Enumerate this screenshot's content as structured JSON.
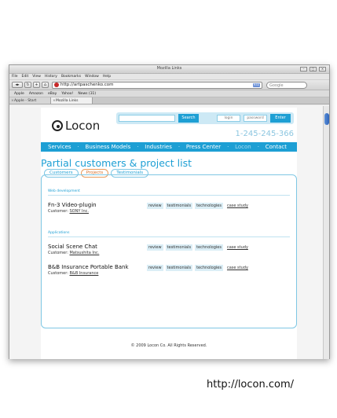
{
  "window": {
    "title": "Mozilla Links",
    "controls": [
      "–",
      "□",
      "×"
    ]
  },
  "menu": [
    "File",
    "Edit",
    "View",
    "History",
    "Bookmarks",
    "Window",
    "Help"
  ],
  "toolbar": {
    "back": "◂",
    "forward": "▸",
    "reload": "↻",
    "home": "⌂",
    "add": "+",
    "url": "http://artpaschenko.com",
    "rss": "RSS",
    "search_placeholder": "Google"
  },
  "bookmarks": [
    "Apple",
    "Amazon",
    "eBay",
    "Yahoo!",
    "News (31)"
  ],
  "tabs": [
    {
      "label": "Apple - Start",
      "active": false
    },
    {
      "label": "Mozilla Links",
      "active": true
    }
  ],
  "site": {
    "logo": "Locon",
    "search_button": "Search",
    "login_placeholder": "login",
    "password_placeholder": "password",
    "enter_button": "Enter",
    "phone": "1-245-245-366",
    "nav": [
      {
        "label": "Services",
        "dim": false
      },
      {
        "label": "Business Models",
        "dim": false
      },
      {
        "label": "Industries",
        "dim": false
      },
      {
        "label": "Press Center",
        "dim": false
      },
      {
        "label": "Locon",
        "dim": true
      },
      {
        "label": "Contact",
        "dim": false
      }
    ],
    "page_title": "Partial customers & project list",
    "panel_tabs": [
      {
        "label": "Customers",
        "active": false
      },
      {
        "label": "Projects",
        "active": true
      },
      {
        "label": "Testimonials",
        "active": false
      }
    ],
    "sections": [
      {
        "title": "Web development",
        "projects": [
          {
            "name": "Fn-3 Video-plugin",
            "customer_label": "Customer:",
            "customer": "SONY Inc."
          }
        ]
      },
      {
        "title": "Applications",
        "projects": [
          {
            "name": "Social Scene Chat",
            "customer_label": "Customer:",
            "customer": "Matsushita Inc."
          },
          {
            "name": "B&B Insurance Portable Bank",
            "customer_label": "Customer:",
            "customer": "B&B Insurance"
          }
        ]
      }
    ],
    "project_tags": [
      "review",
      "testimonials",
      "technologies"
    ],
    "project_link": "case study",
    "footer": "© 2009 Locon Co. All Rights Reserved."
  },
  "caption": "http://locon.com/",
  "colors": {
    "accent": "#1d9fd4",
    "active_tab": "#d8702a"
  }
}
